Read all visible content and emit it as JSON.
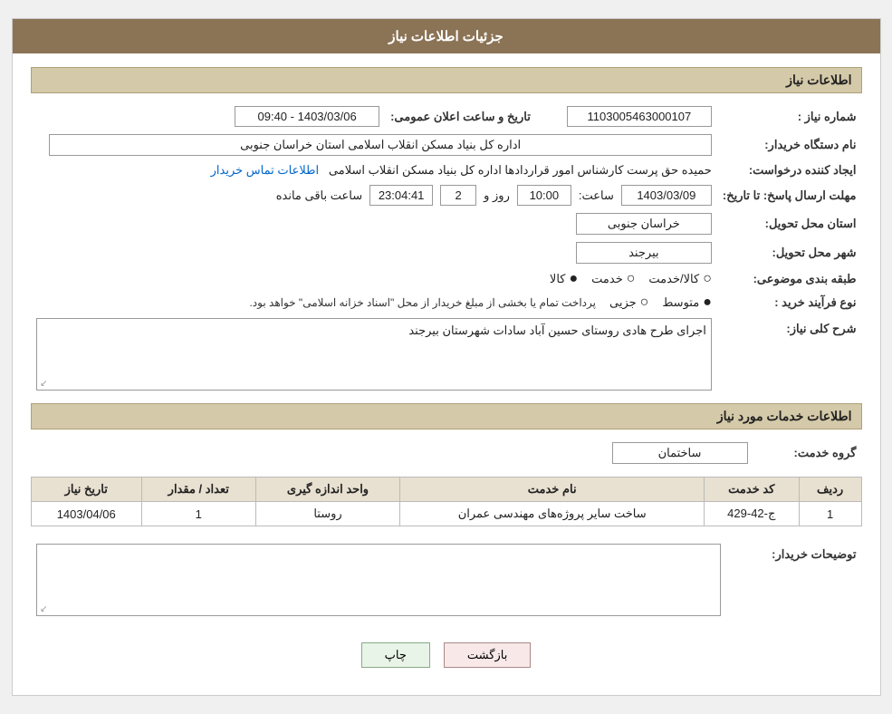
{
  "header": {
    "title": "جزئیات اطلاعات نیاز"
  },
  "section1": {
    "title": "اطلاعات نیاز"
  },
  "fields": {
    "need_number_label": "شماره نیاز :",
    "need_number_value": "1103005463000107",
    "announce_label": "تاریخ و ساعت اعلان عمومی:",
    "announce_value": "1403/03/06 - 09:40",
    "buyer_label": "نام دستگاه خریدار:",
    "buyer_value": "اداره کل بنیاد مسکن انقلاب اسلامی استان خراسان جنوبی",
    "creator_label": "ایجاد کننده درخواست:",
    "creator_value": "حمیده حق پرست کارشناس امور قراردادها اداره کل بنیاد مسکن انقلاب اسلامی",
    "contact_link": "اطلاعات تماس خریدار",
    "deadline_label": "مهلت ارسال پاسخ: تا تاریخ:",
    "deadline_date": "1403/03/09",
    "deadline_time_label": "ساعت:",
    "deadline_time": "10:00",
    "deadline_day_label": "روز و",
    "deadline_day": "2",
    "deadline_remaining_label": "ساعت باقی مانده",
    "deadline_remaining": "23:04:41",
    "province_label": "استان محل تحویل:",
    "province_value": "خراسان جنوبی",
    "city_label": "شهر محل تحویل:",
    "city_value": "بیرجند",
    "category_label": "طبقه بندی موضوعی:",
    "category_options": [
      "کالا",
      "خدمت",
      "کالا/خدمت"
    ],
    "category_selected": "کالا",
    "purchase_type_label": "نوع فرآیند خرید :",
    "purchase_type_note": "پرداخت تمام یا بخشی از مبلغ خریدار از محل \"اسناد خزانه اسلامی\" خواهد بود.",
    "purchase_options": [
      "جزیی",
      "متوسط"
    ],
    "purchase_selected": "متوسط",
    "description_label": "شرح کلی نیاز:",
    "description_value": "اجرای طرح هادی روستای حسین آباد سادات شهرستان بیرجند"
  },
  "section2": {
    "title": "اطلاعات خدمات مورد نیاز"
  },
  "service_group_label": "گروه خدمت:",
  "service_group_value": "ساختمان",
  "table": {
    "headers": [
      "ردیف",
      "کد خدمت",
      "نام خدمت",
      "واحد اندازه گیری",
      "تعداد / مقدار",
      "تاریخ نیاز"
    ],
    "rows": [
      {
        "row": "1",
        "code": "ج-42-429",
        "name": "ساخت سایر پروژه‌های مهندسی عمران",
        "unit": "روستا",
        "quantity": "1",
        "date": "1403/04/06"
      }
    ]
  },
  "buyer_desc_label": "توضیحات خریدار:",
  "buttons": {
    "print": "چاپ",
    "back": "بازگشت"
  }
}
